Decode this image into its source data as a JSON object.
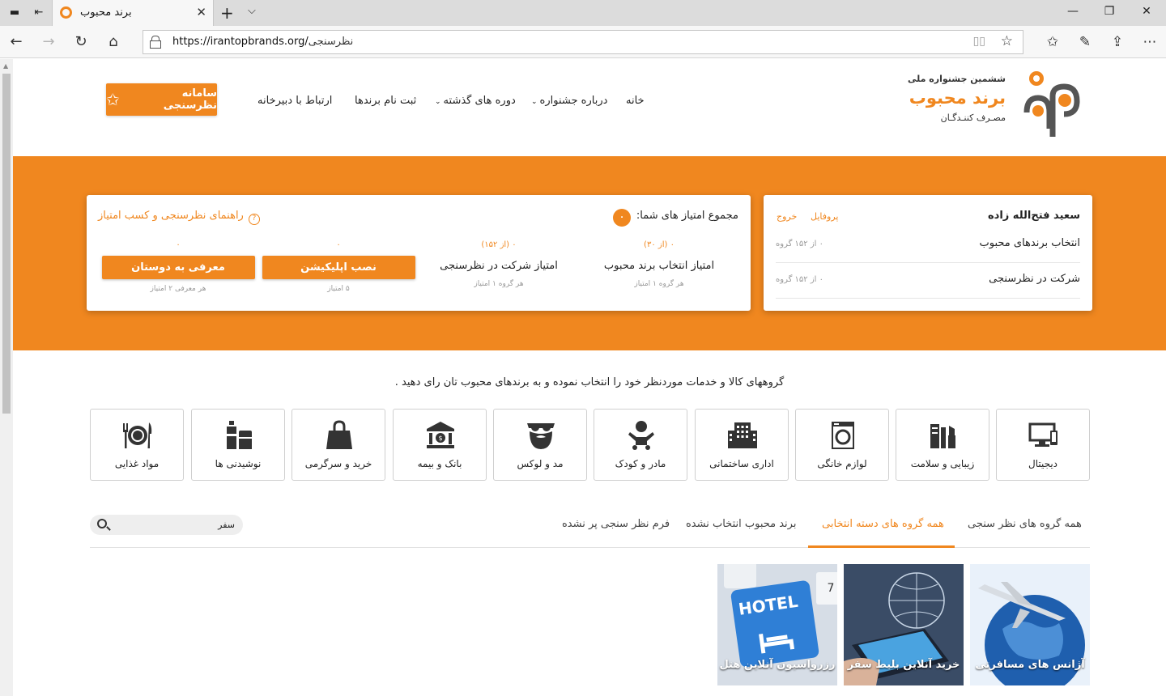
{
  "browser": {
    "tab_title": "برند محبوب",
    "url_host": "https://irantopbrands.org/",
    "url_path": "نظرسنجی"
  },
  "header": {
    "logo_top": "ششمین جشنواره ملی",
    "logo_main": "برند محبوب",
    "logo_sub": "مصـرف کننـدگـان",
    "menu": {
      "home": "خانه",
      "about": "درباره جشنواره",
      "past": "دوره های گذشته",
      "register": "ثبت نام برندها",
      "contact": "ارتباط با دبیرخانه"
    },
    "cta_label": "سامانه نظرسنجی"
  },
  "user_card": {
    "name": "سعید فتح‌الله زاده",
    "profile": "پروفایل",
    "logout": "خروج",
    "rows": [
      {
        "label": "انتخاب برندهای محبوب",
        "count": "۰ از ۱۵۲ گروه"
      },
      {
        "label": "شرکت در نظرسنجی",
        "count": "۰ از ۱۵۲ گروه"
      }
    ]
  },
  "score_card": {
    "total_label": "مجموع امتیاز های شما:",
    "total_value": "۰",
    "guide": "راهنمای نظرسنجی و کسب امتیاز",
    "guide_icon": "question-circle-icon",
    "cols": [
      {
        "value": "۰ (از ۳۰)",
        "name": "امتیاز انتخاب برند محبوب",
        "note": "هر گروه ۱ امتیاز"
      },
      {
        "value": "۰ (از ۱۵۲)",
        "name": "امتیاز شرکت در نظرسنجی",
        "note": "هر گروه ۱ امتیاز"
      },
      {
        "value": "۰",
        "button": "نصب اپلیکیشن",
        "note": "۵ امتیاز"
      },
      {
        "value": "۰",
        "button": "معرفی به دوستان",
        "note": "هر معرفی ۲ امتیاز"
      }
    ]
  },
  "intro": "گروههای کالا و خدمات موردنظر خود را انتخاب نموده و به برندهای محبوب تان رای دهید .",
  "categories": [
    {
      "label": "دیجیتال",
      "icon": "digital-icon"
    },
    {
      "label": "زیبایی و سلامت",
      "icon": "beauty-icon"
    },
    {
      "label": "لوازم خانگی",
      "icon": "washing-machine-icon"
    },
    {
      "label": "اداری ساختمانی",
      "icon": "building-icon"
    },
    {
      "label": "مادر و کودک",
      "icon": "baby-icon"
    },
    {
      "label": "مد و لوکس",
      "icon": "fashion-icon"
    },
    {
      "label": "بانک و بیمه",
      "icon": "bank-icon"
    },
    {
      "label": "خرید و سرگرمی",
      "icon": "shopping-bag-icon"
    },
    {
      "label": "نوشیدنی ها",
      "icon": "drinks-icon"
    },
    {
      "label": "مواد غذایی",
      "icon": "food-icon"
    }
  ],
  "filter_tabs": {
    "all": "همه گروه های نظر سنجی",
    "category": "همه گروه های دسته انتخابی",
    "unselected": "برند محبوب انتخاب نشده",
    "unfilled": "فرم نظر سنجی پر نشده",
    "search_value": "سفر"
  },
  "tiles": [
    {
      "label": "آژانس های مسافرتی"
    },
    {
      "label": "خرید آنلاین بلیط سفر"
    },
    {
      "label": "رزرواسیون آنلاین هتل",
      "image_text": "HOTEL"
    }
  ],
  "colors": {
    "accent": "#f0871f"
  }
}
